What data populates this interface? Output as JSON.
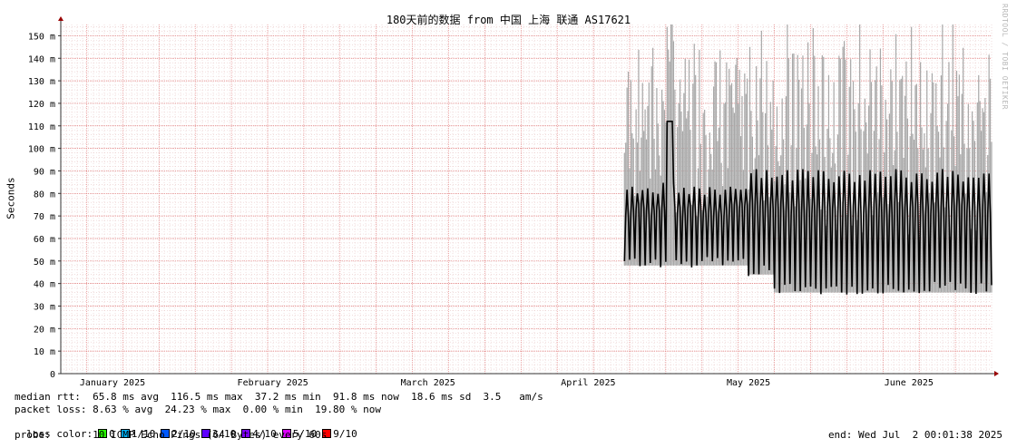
{
  "chart_data": {
    "type": "line",
    "title": "180天前的数据 from 中国 上海 联通 AS17621",
    "ylabel": "Seconds",
    "watermark": "RRDTOOL / TOBI OETIKER",
    "ylim": [
      0,
      155
    ],
    "y_ticks": [
      0,
      10,
      20,
      30,
      40,
      50,
      60,
      70,
      80,
      90,
      100,
      110,
      120,
      130,
      140,
      150
    ],
    "y_tick_labels": [
      "0",
      "10 m",
      "20 m",
      "30 m",
      "40 m",
      "50 m",
      "60 m",
      "70 m",
      "80 m",
      "90 m",
      "100 m",
      "110 m",
      "120 m",
      "130 m",
      "140 m",
      "150 m"
    ],
    "x_range_days": [
      0,
      180
    ],
    "x_tick_labels": [
      {
        "label": "January 2025",
        "day": 10
      },
      {
        "label": "February 2025",
        "day": 41
      },
      {
        "label": "March 2025",
        "day": 71
      },
      {
        "label": "April 2025",
        "day": 102
      },
      {
        "label": "May 2025",
        "day": 133
      },
      {
        "label": "June 2025",
        "day": 164
      }
    ],
    "data_start_day": 109,
    "grid": true,
    "colors": {
      "grid": "#e8c8c8",
      "smoke": "#a8a8a8",
      "median": "#000000",
      "axis": "#333333",
      "arrow": "#990000"
    }
  },
  "stats": {
    "median_rtt": "median rtt:  65.8 ms avg  116.5 ms max  37.2 ms min  91.8 ms now  18.6 ms sd  3.5   am/s",
    "packet_loss": "packet loss: 8.63 % avg  24.23 % max  0.00 % min  19.80 % now"
  },
  "legend": {
    "label": "loss color:",
    "items": [
      {
        "label": "0",
        "color": "#26ff00"
      },
      {
        "label": "1/10",
        "color": "#00b8ff"
      },
      {
        "label": "2/10",
        "color": "#0059ff"
      },
      {
        "label": "3/10",
        "color": "#5e00ff"
      },
      {
        "label": "4/10",
        "color": "#7e00ff"
      },
      {
        "label": "5/10",
        "color": "#dd00ff"
      },
      {
        "label": "9/10",
        "color": "#ff0000"
      }
    ]
  },
  "probe": "probe:       10 ICMP Echo Pings (64 Bytes) every 60s",
  "end": "end: Wed Jul  2 00:01:38 2025"
}
